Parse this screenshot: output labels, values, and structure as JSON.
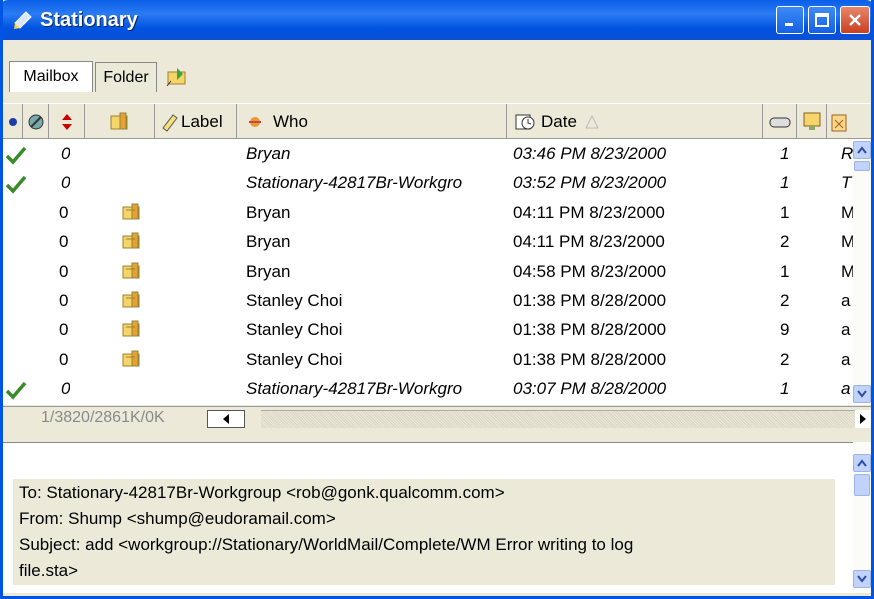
{
  "window": {
    "title": "Stationary",
    "buttons": {
      "minimize": "minimize",
      "maximize": "maximize",
      "close": "close"
    }
  },
  "tabs": [
    {
      "label": "Mailbox"
    },
    {
      "label": "Folder"
    }
  ],
  "columns": {
    "status": "",
    "priority": "",
    "attachment": "",
    "label": "Label",
    "who": "Who",
    "date": "Date",
    "size": "",
    "server": "",
    "subject": ""
  },
  "rows": [
    {
      "check": true,
      "priority": "0",
      "attach": false,
      "who": "Bryan",
      "date": "03:46 PM 8/23/2000",
      "size": "1",
      "subject": "R",
      "italic": true
    },
    {
      "check": true,
      "priority": "0",
      "attach": false,
      "who": "Stationary-42817Br-Workgro",
      "date": "03:52 PM 8/23/2000",
      "size": "1",
      "subject": "T",
      "italic": true
    },
    {
      "check": false,
      "priority": "0",
      "attach": true,
      "who": "Bryan",
      "date": "04:11 PM 8/23/2000",
      "size": "1",
      "subject": "M",
      "italic": false
    },
    {
      "check": false,
      "priority": "0",
      "attach": true,
      "who": "Bryan",
      "date": "04:11 PM 8/23/2000",
      "size": "2",
      "subject": "M",
      "italic": false
    },
    {
      "check": false,
      "priority": "0",
      "attach": true,
      "who": "Bryan",
      "date": "04:58 PM 8/23/2000",
      "size": "1",
      "subject": "M",
      "italic": false
    },
    {
      "check": false,
      "priority": "0",
      "attach": true,
      "who": "Stanley Choi",
      "date": "01:38 PM 8/28/2000",
      "size": "2",
      "subject": "a",
      "italic": false
    },
    {
      "check": false,
      "priority": "0",
      "attach": true,
      "who": "Stanley Choi",
      "date": "01:38 PM 8/28/2000",
      "size": "9",
      "subject": "a",
      "italic": false
    },
    {
      "check": false,
      "priority": "0",
      "attach": true,
      "who": "Stanley Choi",
      "date": "01:38 PM 8/28/2000",
      "size": "2",
      "subject": "a",
      "italic": false
    },
    {
      "check": true,
      "priority": "0",
      "attach": false,
      "who": "Stationary-42817Br-Workgro",
      "date": "03:07 PM 8/28/2000",
      "size": "1",
      "subject": "a",
      "italic": true
    }
  ],
  "status": {
    "text": "1/3820/2861K/0K"
  },
  "preview": {
    "to": "To: Stationary-42817Br-Workgroup <rob@gonk.qualcomm.com>",
    "from": "From: Shump <shump@eudoramail.com>",
    "subject": "Subject: add <workgroup://Stationary/WorldMail/Complete/WM Error writing to log",
    "subject_cont": "file.sta>"
  },
  "icons": {
    "app": "stationery-icon",
    "sort": "sort-ascending-icon"
  }
}
